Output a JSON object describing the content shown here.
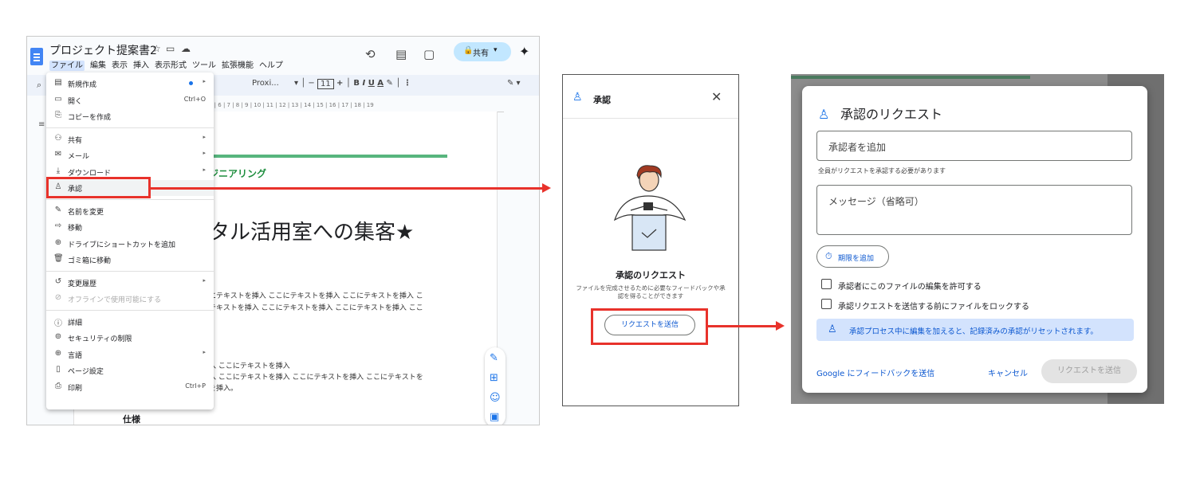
{
  "docs": {
    "doc_title": "プロジェクト提案書2",
    "menubar": [
      "ファイル",
      "編集",
      "表示",
      "挿入",
      "表示形式",
      "ツール",
      "拡張機能",
      "ヘルプ"
    ],
    "share_label": "共有",
    "font_name": "Proxi...",
    "font_size": "11",
    "ruler": "5 | 6 | 7 | 8 | 9 | 10 | 11 | 12 | 13 | 14 | 15 | 16 | 17 | 18 | 19",
    "heading_green": "ジニアリング",
    "heading_big": "タル活用室への集客★",
    "body_lines": [
      "にテキストを挿入 ここにテキストを挿入 ここにテキストを挿入 こ",
      "テキストを挿入 ここにテキストを挿入 ここにテキストを挿入 ここ",
      "入 ここにテキストを挿入",
      "入 ここにテキストを挿入 ここにテキストを挿入 ここにテキストを",
      "を挿入。"
    ],
    "spec_heading": "仕様"
  },
  "file_menu": [
    {
      "icon": "▤",
      "label": "新規作成",
      "submenu": true,
      "dot": true
    },
    {
      "icon": "▭",
      "label": "開く",
      "shortcut": "Ctrl+O"
    },
    {
      "icon": "⎘",
      "label": "コピーを作成"
    },
    {
      "sep": true
    },
    {
      "icon": "⚇",
      "label": "共有",
      "submenu": true
    },
    {
      "icon": "✉",
      "label": "メール",
      "submenu": true
    },
    {
      "icon": "⤓",
      "label": "ダウンロード",
      "submenu": true
    },
    {
      "icon": "♙",
      "label": "承認",
      "highlight": true
    },
    {
      "sep": true
    },
    {
      "icon": "✎",
      "label": "名前を変更"
    },
    {
      "icon": "⇨",
      "label": "移動"
    },
    {
      "icon": "⊕",
      "label": "ドライブにショートカットを追加"
    },
    {
      "icon": "🗑",
      "label": "ゴミ箱に移動"
    },
    {
      "sep": true
    },
    {
      "icon": "↺",
      "label": "変更履歴",
      "submenu": true
    },
    {
      "icon": "⊘",
      "label": "オフラインで使用可能にする",
      "disabled": true
    },
    {
      "sep": true
    },
    {
      "icon": "ⓘ",
      "label": "詳細"
    },
    {
      "icon": "⊚",
      "label": "セキュリティの制限"
    },
    {
      "icon": "⊕",
      "label": "言語",
      "submenu": true
    },
    {
      "icon": "▯",
      "label": "ページ設定"
    },
    {
      "icon": "⎙",
      "label": "印刷",
      "shortcut": "Ctrl+P"
    }
  ],
  "side_panel": {
    "title": "承認",
    "heading": "承認のリクエスト",
    "description": "ファイルを完成させるために必要なフィードバックや承認を得ることができます",
    "button": "リクエストを送信"
  },
  "dialog": {
    "title": "承認のリクエスト",
    "approver_placeholder": "承認者を追加",
    "approver_hint": "全員がリクエストを承認する必要があります",
    "message_placeholder": "メッセージ（省略可）",
    "deadline_button": "期限を追加",
    "checkbox_edit": "承認者にこのファイルの編集を許可する",
    "checkbox_lock": "承認リクエストを送信する前にファイルをロックする",
    "info": "承認プロセス中に編集を加えると、記録済みの承認がリセットされます。",
    "feedback_link": "Google にフィードバックを送信",
    "cancel": "キャンセル",
    "send": "リクエストを送信"
  },
  "colors": {
    "accent": "#1a73e8",
    "highlight": "#e8322b",
    "share_bg": "#c2e7ff",
    "info_bg": "#d3e3fd"
  }
}
